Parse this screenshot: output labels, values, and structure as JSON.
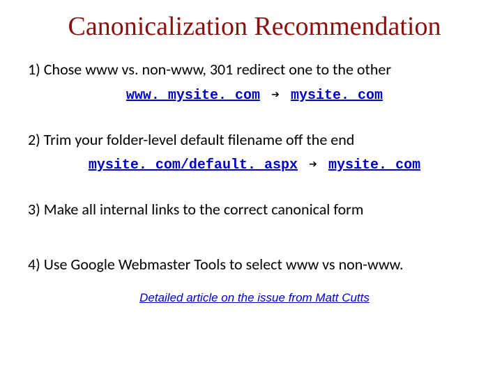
{
  "title": "Canonicalization Recommendation",
  "item1": "1) Chose www vs. non-www, 301 redirect one to the other",
  "ex1_from": "www. mysite. com",
  "arrow": "➔",
  "ex1_to": "mysite. com",
  "item2": "2) Trim your folder-level default filename off the end",
  "ex2_from": "mysite. com/default. aspx",
  "ex2_to": "mysite. com",
  "item3": "3) Make all internal links to the correct canonical form",
  "item4": "4) Use Google Webmaster Tools to select www vs non-www.",
  "footer": "Detailed article on the issue from Matt Cutts"
}
